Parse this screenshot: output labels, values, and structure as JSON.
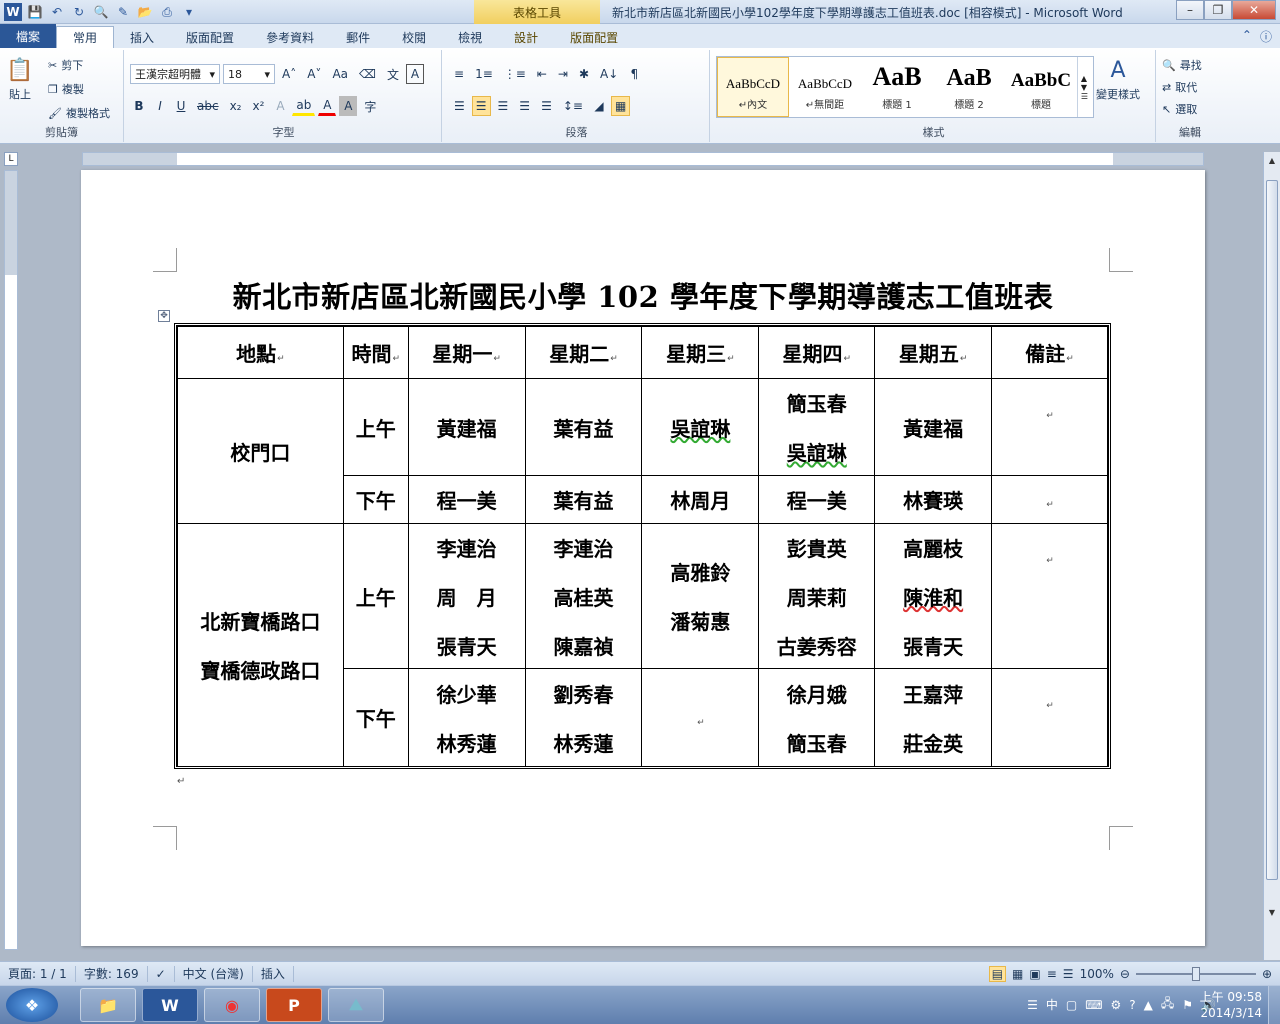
{
  "window": {
    "title": "新北市新店區北新國民小學102學年度下學期導護志工值班表.doc [相容模式] - Microsoft Word",
    "context_tab_group": "表格工具",
    "app_icon": "W"
  },
  "tabs": [
    "檔案",
    "常用",
    "插入",
    "版面配置",
    "參考資料",
    "郵件",
    "校閱",
    "檢視",
    "設計",
    "版面配置"
  ],
  "ribbon": {
    "clipboard": {
      "paste": "貼上",
      "cut": "剪下",
      "copy": "複製",
      "format_painter": "複製格式",
      "label": "剪貼簿"
    },
    "font": {
      "name": "王漢宗超明體",
      "size": "18",
      "label": "字型"
    },
    "paragraph": {
      "label": "段落"
    },
    "styles": {
      "label": "樣式",
      "items": [
        {
          "sample": "AaBbCcD",
          "name": "↵內文"
        },
        {
          "sample": "AaBbCcD",
          "name": "↵無間距"
        },
        {
          "sample": "AaB",
          "name": "標題 1"
        },
        {
          "sample": "AaB",
          "name": "標題 2"
        },
        {
          "sample": "AaBbC",
          "name": "標題"
        }
      ],
      "change": "變更樣式"
    },
    "editing": {
      "find": "尋找",
      "replace": "取代",
      "select": "選取",
      "label": "編輯"
    }
  },
  "document": {
    "title": "新北市新店區北新國民小學 102 學年度下學期導護志工值班表",
    "header": [
      "地點",
      "時間",
      "星期一",
      "星期二",
      "星期三",
      "星期四",
      "星期五",
      "備註"
    ],
    "rows": [
      {
        "location": [
          "校門口"
        ],
        "time": "上午",
        "mon": [
          "黃建福"
        ],
        "tue": [
          "葉有益"
        ],
        "wed": [
          "吳誼琳"
        ],
        "thu": [
          "簡玉春",
          "吳誼琳"
        ],
        "fri": [
          "黃建福"
        ],
        "note": ""
      },
      {
        "location": null,
        "time": "下午",
        "mon": [
          "程一美"
        ],
        "tue": [
          "葉有益"
        ],
        "wed": [
          "林周月"
        ],
        "thu": [
          "程一美"
        ],
        "fri": [
          "林賽瑛"
        ],
        "note": ""
      },
      {
        "location": [
          "北新寶橋路口",
          "寶橋德政路口"
        ],
        "time": "上午",
        "mon": [
          "李連治",
          "周　月",
          "張青天"
        ],
        "tue": [
          "李連治",
          "高桂英",
          "陳嘉禎"
        ],
        "wed": [
          "高雅鈴",
          "潘菊惠"
        ],
        "thu": [
          "彭貴英",
          "周茉莉",
          "古姜秀容"
        ],
        "fri": [
          "高麗枝",
          "陳淮和",
          "張青天"
        ],
        "note": ""
      },
      {
        "location": null,
        "time": "下午",
        "mon": [
          "徐少華",
          "林秀蓮"
        ],
        "tue": [
          "劉秀春",
          "林秀蓮"
        ],
        "wed": [],
        "thu": [
          "徐月娥",
          "簡玉春"
        ],
        "fri": [
          "王嘉萍",
          "莊金英"
        ],
        "note": ""
      }
    ]
  },
  "status": {
    "page": "頁面: 1 / 1",
    "words": "字數: 169",
    "language": "中文 (台灣)",
    "mode": "插入",
    "zoom": "100%"
  },
  "taskbar": {
    "time": "上午 09:58",
    "date": "2014/3/14",
    "ime": "中"
  },
  "colors": {
    "file_tab": "#2b5797",
    "ribbon_bg": "#dfe9f5",
    "context_tab": "#f1cf5f"
  }
}
